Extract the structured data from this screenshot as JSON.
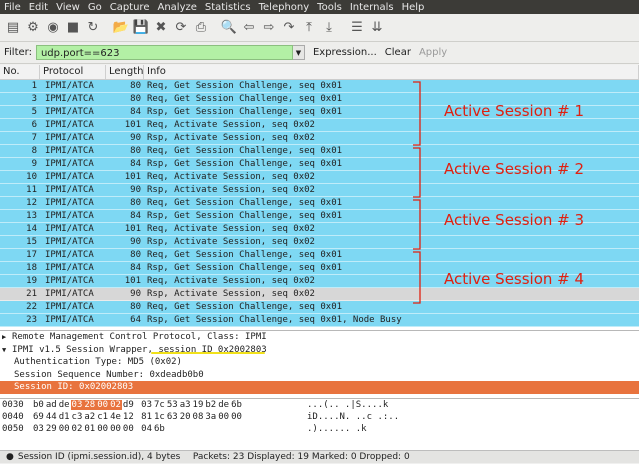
{
  "menu": [
    "File",
    "Edit",
    "View",
    "Go",
    "Capture",
    "Analyze",
    "Statistics",
    "Telephony",
    "Tools",
    "Internals",
    "Help"
  ],
  "toolbar_icons": [
    "interface-list-icon",
    "capture-options-icon",
    "start-capture-icon",
    "stop-capture-icon",
    "restart-capture-icon",
    "open-file-icon",
    "save-file-icon",
    "close-file-icon",
    "reload-icon",
    "print-icon",
    "find-packet-icon",
    "go-back-icon",
    "go-forward-icon",
    "go-to-packet-icon",
    "go-first-icon",
    "go-last-icon",
    "colorize-icon",
    "autoscroll-icon"
  ],
  "filter": {
    "label": "Filter:",
    "value": "udp.port==623",
    "expression": "Expression...",
    "clear": "Clear",
    "apply": "Apply"
  },
  "columns": {
    "no": "No.",
    "protocol": "Protocol",
    "length": "Length",
    "info": "Info"
  },
  "packets": [
    {
      "no": "1",
      "protocol": "IPMI/ATCA",
      "length": "80",
      "info": "Req, Get Session Challenge, seq 0x01"
    },
    {
      "no": "3",
      "protocol": "IPMI/ATCA",
      "length": "80",
      "info": "Req, Get Session Challenge, seq 0x01"
    },
    {
      "no": "5",
      "protocol": "IPMI/ATCA",
      "length": "84",
      "info": "Rsp, Get Session Challenge, seq 0x01"
    },
    {
      "no": "6",
      "protocol": "IPMI/ATCA",
      "length": "101",
      "info": "Req, Activate Session, seq 0x02"
    },
    {
      "no": "7",
      "protocol": "IPMI/ATCA",
      "length": "90",
      "info": "Rsp, Activate Session, seq 0x02"
    },
    {
      "no": "8",
      "protocol": "IPMI/ATCA",
      "length": "80",
      "info": "Req, Get Session Challenge, seq 0x01"
    },
    {
      "no": "9",
      "protocol": "IPMI/ATCA",
      "length": "84",
      "info": "Rsp, Get Session Challenge, seq 0x01"
    },
    {
      "no": "10",
      "protocol": "IPMI/ATCA",
      "length": "101",
      "info": "Req, Activate Session, seq 0x02"
    },
    {
      "no": "11",
      "protocol": "IPMI/ATCA",
      "length": "90",
      "info": "Rsp, Activate Session, seq 0x02"
    },
    {
      "no": "12",
      "protocol": "IPMI/ATCA",
      "length": "80",
      "info": "Req, Get Session Challenge, seq 0x01"
    },
    {
      "no": "13",
      "protocol": "IPMI/ATCA",
      "length": "84",
      "info": "Rsp, Get Session Challenge, seq 0x01"
    },
    {
      "no": "14",
      "protocol": "IPMI/ATCA",
      "length": "101",
      "info": "Req, Activate Session, seq 0x02"
    },
    {
      "no": "15",
      "protocol": "IPMI/ATCA",
      "length": "90",
      "info": "Rsp, Activate Session, seq 0x02"
    },
    {
      "no": "17",
      "protocol": "IPMI/ATCA",
      "length": "80",
      "info": "Req, Get Session Challenge, seq 0x01"
    },
    {
      "no": "18",
      "protocol": "IPMI/ATCA",
      "length": "84",
      "info": "Rsp, Get Session Challenge, seq 0x01"
    },
    {
      "no": "19",
      "protocol": "IPMI/ATCA",
      "length": "101",
      "info": "Req, Activate Session, seq 0x02"
    },
    {
      "no": "21",
      "protocol": "IPMI/ATCA",
      "length": "90",
      "info": "Rsp, Activate Session, seq 0x02"
    },
    {
      "no": "22",
      "protocol": "IPMI/ATCA",
      "length": "80",
      "info": "Req, Get Session Challenge, seq 0x01"
    },
    {
      "no": "23",
      "protocol": "IPMI/ATCA",
      "length": "64",
      "info": "Rsp, Get Session Challenge, seq 0x01, Node Busy"
    }
  ],
  "selected_packet_no": "21",
  "row_color": "#7ed8f3",
  "selected_row_color": "#d7d7d7",
  "annotations": {
    "color": "#e02010",
    "labels": [
      "Active Session # 1",
      "Active Session # 2",
      "Active Session # 3",
      "Active Session # 4"
    ]
  },
  "details": {
    "rmcp": "Remote Management Control Protocol, Class: IPMI",
    "ipmi_prefix": "IPMI v1.5 Session Wrapper, ",
    "ipmi_session": "session ID 0x2002803",
    "auth_type": "Authentication Type: MD5 (0x02)",
    "seq_number": "Session Sequence Number: 0xdeadb0b0",
    "session_id": "Session ID: 0x02002803"
  },
  "hex": [
    {
      "offset": "0030",
      "bytes": [
        "b0",
        "ad",
        "de",
        "03",
        "28",
        "00",
        "02",
        "d9",
        "03",
        "7c",
        "53",
        "a3",
        "19",
        "b2",
        "de",
        "6b"
      ],
      "hl": [
        3,
        4,
        5,
        6
      ],
      "ascii": "...(.. .|S....k"
    },
    {
      "offset": "0040",
      "bytes": [
        "69",
        "44",
        "d1",
        "c3",
        "a2",
        "c1",
        "4e",
        "12",
        "81",
        "1c",
        "63",
        "20",
        "08",
        "3a",
        "00",
        "00"
      ],
      "hl": [],
      "ascii": "iD....N. ..c .:.."
    },
    {
      "offset": "0050",
      "bytes": [
        "03",
        "29",
        "00",
        "02",
        "01",
        "00",
        "00",
        "00",
        "04",
        "6b"
      ],
      "hl": [],
      "ascii": ".)...... .k"
    }
  ],
  "status": {
    "field": "Session ID (ipmi.session.id), 4 bytes",
    "counts": "Packets: 23 Displayed: 19 Marked: 0 Dropped: 0"
  }
}
